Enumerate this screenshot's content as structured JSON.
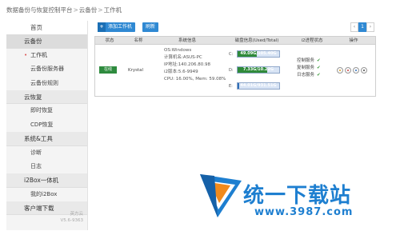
{
  "breadcrumb": [
    "数据备份与恢复控制平台",
    "云备份",
    "工作机"
  ],
  "sidebar": {
    "home": "首页",
    "groups": [
      {
        "label": "云备份",
        "items": [
          "工作机",
          "云备份服务器",
          "云备份规则"
        ]
      },
      {
        "label": "云恢复",
        "items": [
          "即时恢复",
          "CDP恢复"
        ]
      },
      {
        "label": "系统&工具",
        "items": [
          "诊断",
          "日志"
        ]
      },
      {
        "label": "i2Box一体机",
        "items": [
          "我的i2Box"
        ]
      },
      {
        "label": "客户端下载",
        "items": []
      }
    ],
    "footer_line1": "英方云",
    "footer_line2": "V5.6-9363"
  },
  "toolbar": {
    "add_label": "添加工作机",
    "refresh_label": "刷新",
    "pager_prev": "‹",
    "pager_current": "1",
    "pager_next": "›"
  },
  "table": {
    "headers": [
      "状态",
      "名称",
      "系统信息",
      "磁盘信息(Used/Total)",
      "i2进程状态",
      "操作"
    ],
    "row": {
      "status": "在线",
      "name": "Krystal",
      "sysinfo": [
        "OS:Windows",
        "计算机名:ASUS-PC",
        "IP地址:140.206.80.98",
        "i2版本:5.6-9949",
        "CPU: 16.00%, Mem: 59.08%"
      ],
      "disks": [
        {
          "label": "C:",
          "text": "49.09G/105.40G",
          "fraction": 0.466,
          "color": "#2f8a3a"
        },
        {
          "label": "D:",
          "text": "7.33G/10.22G",
          "fraction": 0.717,
          "color": "#2f8a3a"
        },
        {
          "label": "E:",
          "text": "44.01G/931.51G",
          "fraction": 0.047,
          "color": "#2f6fb8"
        }
      ],
      "services": [
        "控制服务",
        "复制服务",
        "日志服务"
      ],
      "ops": [
        "edit-icon",
        "delete-icon",
        "info-icon",
        "settings-icon"
      ]
    }
  },
  "watermark": {
    "title": "统一下载站",
    "url": "www.3987.com",
    "colors": {
      "blue": "#1e7fd0",
      "orange": "#f08a1c"
    }
  }
}
